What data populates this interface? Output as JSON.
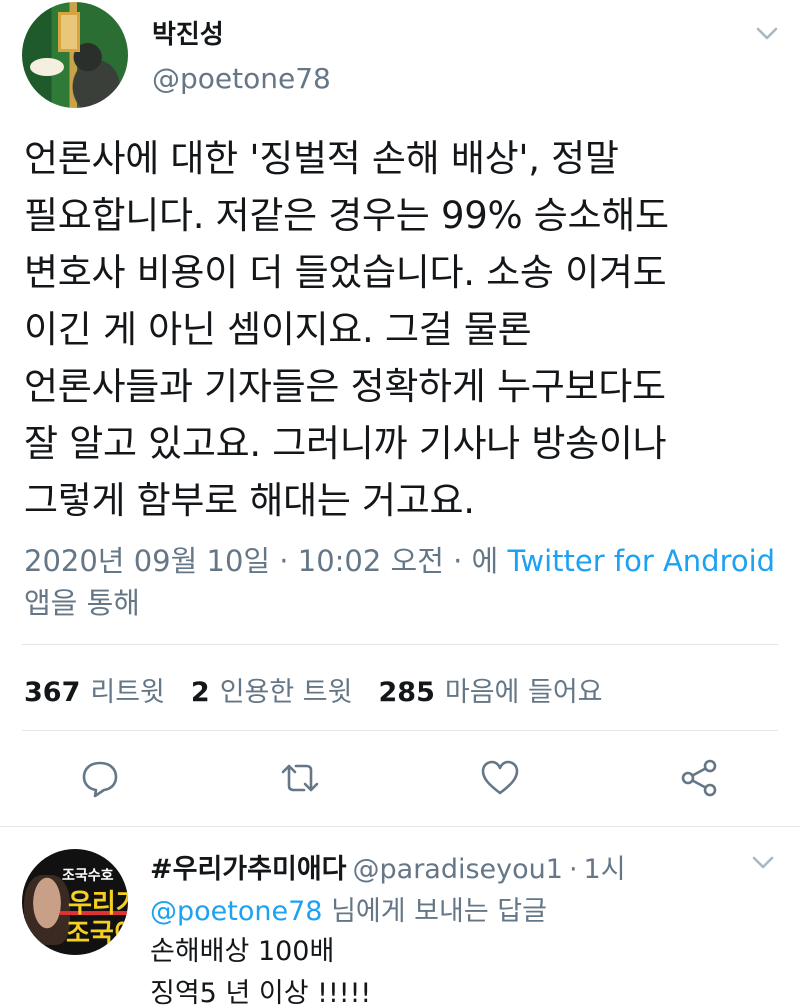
{
  "tweet": {
    "author_name": "박진성",
    "author_handle": "@poetone78",
    "text": "언론사에 대한 '징벌적 손해 배상', 정말\n필요합니다. 저같은 경우는 99% 승소해도\n변호사 비용이 더 들었습니다. 소송 이겨도\n이긴 게 아닌 셈이지요. 그걸 물론\n언론사들과 기자들은 정확하게 누구보다도\n잘 알고 있고요. 그러니까 기사나 방송이나\n그렇게 함부로 해대는 거고요.",
    "timestamp": "2020년 09월 10일 · 10:02 오전 · 에",
    "source": "Twitter for Android",
    "source_suffix": "앱을 통해",
    "stats": {
      "retweets": "367",
      "retweets_label": "리트윗",
      "quotes": "2",
      "quotes_label": "인용한 트윗",
      "likes": "285",
      "likes_label": "마음에 들어요"
    },
    "actions": [
      "reply-icon",
      "retweet-icon",
      "heart-icon",
      "share-icon"
    ]
  },
  "reply": {
    "author_name": "#우리가추미애다",
    "author_handle": "@paradiseyou1",
    "time": "1시",
    "replying_mention": "@poetone78",
    "replying_suffix": "님에게 보내는 답글",
    "text": "손해배상 100배\n징역5 년  이상 !!!!!",
    "avatar_text": [
      "조국수호",
      "우리가",
      "조국이다"
    ]
  },
  "colors": {
    "text": "#14171a",
    "muted": "#657786",
    "accent": "#1da1f2",
    "divider": "#e1e8ed"
  }
}
